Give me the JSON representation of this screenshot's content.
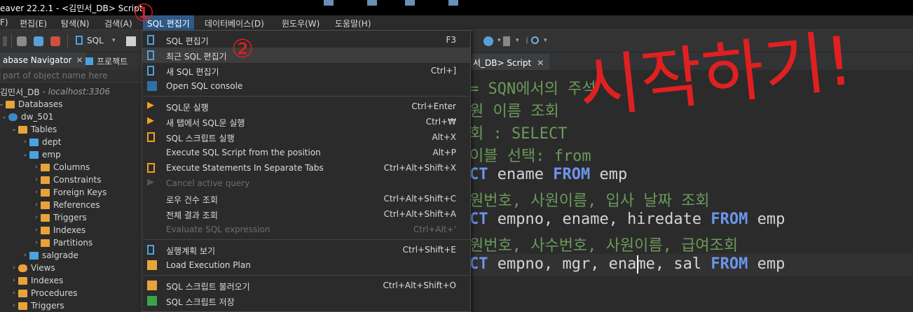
{
  "window": {
    "title": "eaver 22.2.1 - <김민서_DB> Script"
  },
  "menubar": {
    "items": [
      {
        "label": "F)"
      },
      {
        "label": "편집(E)"
      },
      {
        "label": "탐색(N)"
      },
      {
        "label": "검색(A)"
      },
      {
        "label": "SQL 편집기"
      },
      {
        "label": "데이터베이스(D)"
      },
      {
        "label": "윈도우(W)"
      },
      {
        "label": "도움말(H)"
      }
    ]
  },
  "toolbar": {
    "sql_label": "SQL"
  },
  "navigator": {
    "tab_label": "abase Navigator",
    "tab2_label": "프로젝트",
    "filter_placeholder": "part of object name here",
    "connection": {
      "name": "김민서_DB",
      "host": "- localhost:3306"
    },
    "tree": {
      "databases": "Databases",
      "db": "dw_501",
      "tables": "Tables",
      "dept": "dept",
      "emp": "emp",
      "columns": "Columns",
      "constraints": "Constraints",
      "foreign_keys": "Foreign Keys",
      "references": "References",
      "triggers": "Triggers",
      "indexes": "Indexes",
      "partitions": "Partitions",
      "salgrade": "salgrade",
      "views": "Views",
      "indexes_top": "Indexes",
      "procedures": "Procedures",
      "triggers_top": "Triggers"
    }
  },
  "editor": {
    "tab_label": "서_DB> Script",
    "lines": [
      {
        "text": "= SQN에서의 주석"
      },
      {
        "text": "원 이름 조회"
      },
      {
        "text": "회 : SELECT"
      },
      {
        "text": "이블 선택: from"
      },
      {
        "kw1": "CT",
        "mid": " ename ",
        "kw2": "FROM",
        "tail": " emp"
      },
      {
        "text": "원번호, 사원이름, 입사 날짜 조회"
      },
      {
        "kw1": "CT",
        "mid": " empno, ename, hiredate ",
        "kw2": "FROM",
        "tail": " emp"
      },
      {
        "text": "원번호, 사수번호, 사원이름, 급여조회"
      },
      {
        "kw1": "CT",
        "mid": " empno, mgr, ename, sal ",
        "kw2": "FROM",
        "tail": " emp"
      }
    ]
  },
  "dropdown": {
    "items": [
      {
        "label": "SQL 편집기",
        "key": "F3"
      },
      {
        "label": "최근 SQL 편집기",
        "key": ""
      },
      {
        "label": "새 SQL 편집기",
        "key": "Ctrl+]"
      },
      {
        "label": "Open SQL console",
        "key": ""
      },
      {
        "label": "SQL문 실행",
        "key": "Ctrl+Enter"
      },
      {
        "label": "새 탭에서 SQL문 실행",
        "key": "Ctrl+₩"
      },
      {
        "label": "SQL 스크립트 실행",
        "key": "Alt+X"
      },
      {
        "label": "Execute SQL Script from the position",
        "key": "Alt+P"
      },
      {
        "label": "Execute Statements In Separate Tabs",
        "key": "Ctrl+Alt+Shift+X"
      },
      {
        "label": "Cancel active query",
        "key": ""
      },
      {
        "label": "로우 건수 조회",
        "key": "Ctrl+Alt+Shift+C"
      },
      {
        "label": "전체 결과 조회",
        "key": "Ctrl+Alt+Shift+A"
      },
      {
        "label": "Evaluate SQL expression",
        "key": "Ctrl+Alt+'"
      },
      {
        "label": "실행계획 보기",
        "key": "Ctrl+Shift+E"
      },
      {
        "label": "Load Execution Plan",
        "key": ""
      },
      {
        "label": "SQL 스크립트 불러오기",
        "key": "Ctrl+Alt+Shift+O"
      },
      {
        "label": "SQL 스크립트 저장",
        "key": ""
      }
    ]
  },
  "annotations": {
    "mark1": "①",
    "mark2": "②",
    "handwriting": "시작하기!"
  },
  "colors": {
    "highlight_menu": "#2f5a86",
    "annotation_red": "#e02020",
    "keyword_blue": "#6c95eb",
    "comment_green": "#6a9a5a"
  }
}
